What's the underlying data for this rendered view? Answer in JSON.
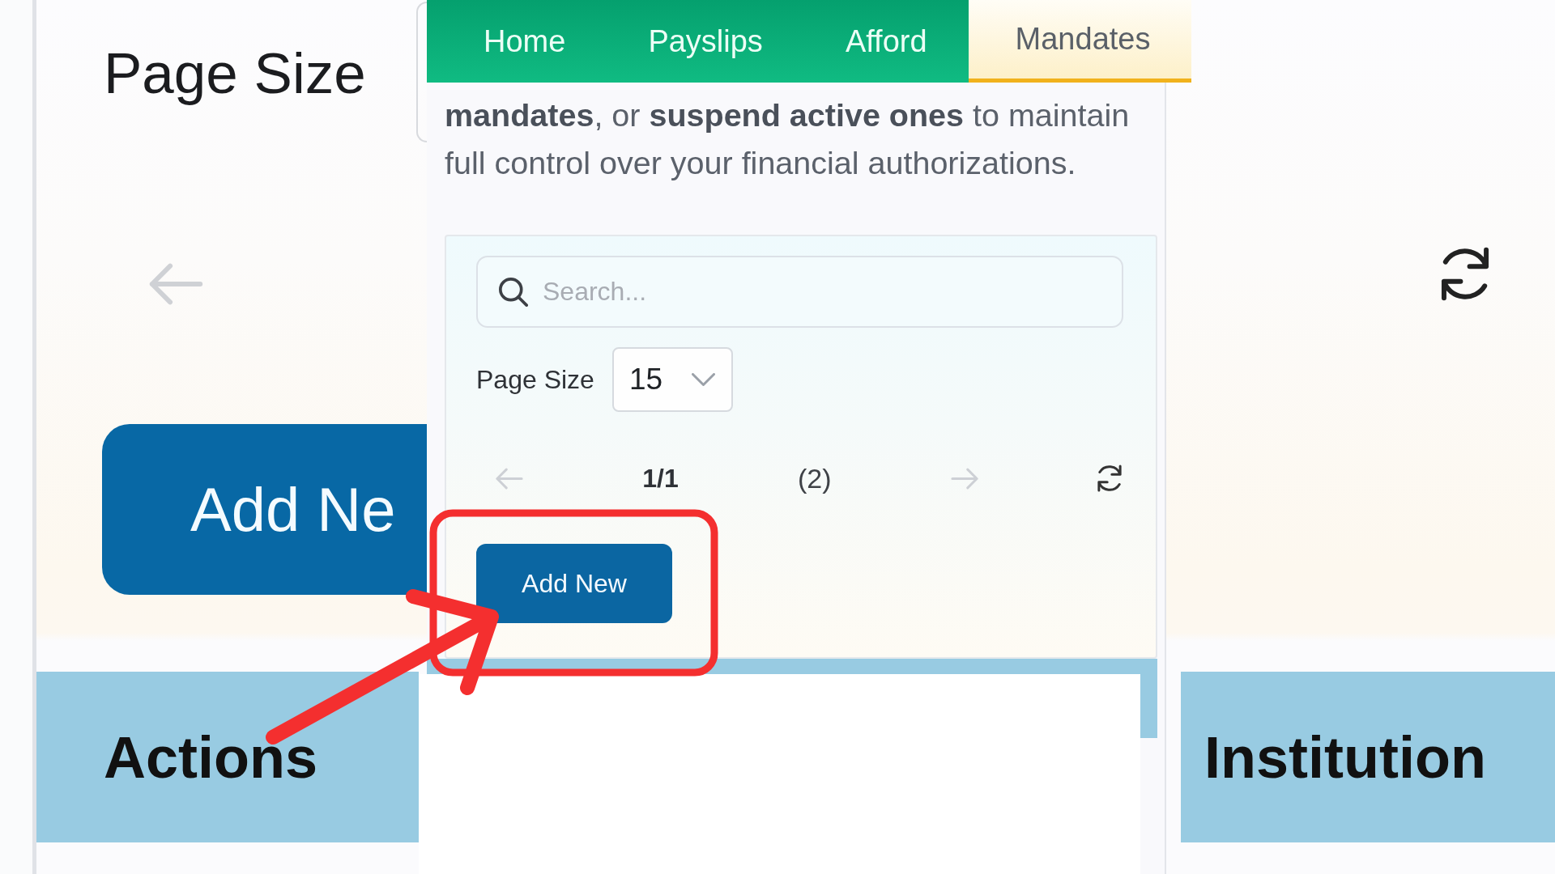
{
  "background": {
    "page_size_label": "Page Size",
    "previous_disabled": true,
    "add_button": "Add Ne",
    "columns": [
      "Actions",
      "Institution"
    ]
  },
  "overlay": {
    "tabs": [
      {
        "label": "Home",
        "selected": false
      },
      {
        "label": "Payslips",
        "selected": false
      },
      {
        "label": "Afford",
        "selected": false
      },
      {
        "label": "Mandates",
        "selected": true
      }
    ],
    "intro": "**mandates**, or **suspend active ones** to maintain full control over your financial authorizations.",
    "search": {
      "placeholder": "Search..."
    },
    "page_size": {
      "label": "Page Size",
      "value": "15"
    },
    "pagination": {
      "page": "1/1",
      "count": "(2)",
      "previous_disabled": true,
      "next_disabled": true
    },
    "add_button": "Add New"
  },
  "annotation": {
    "frame": true,
    "arrow": true
  }
}
